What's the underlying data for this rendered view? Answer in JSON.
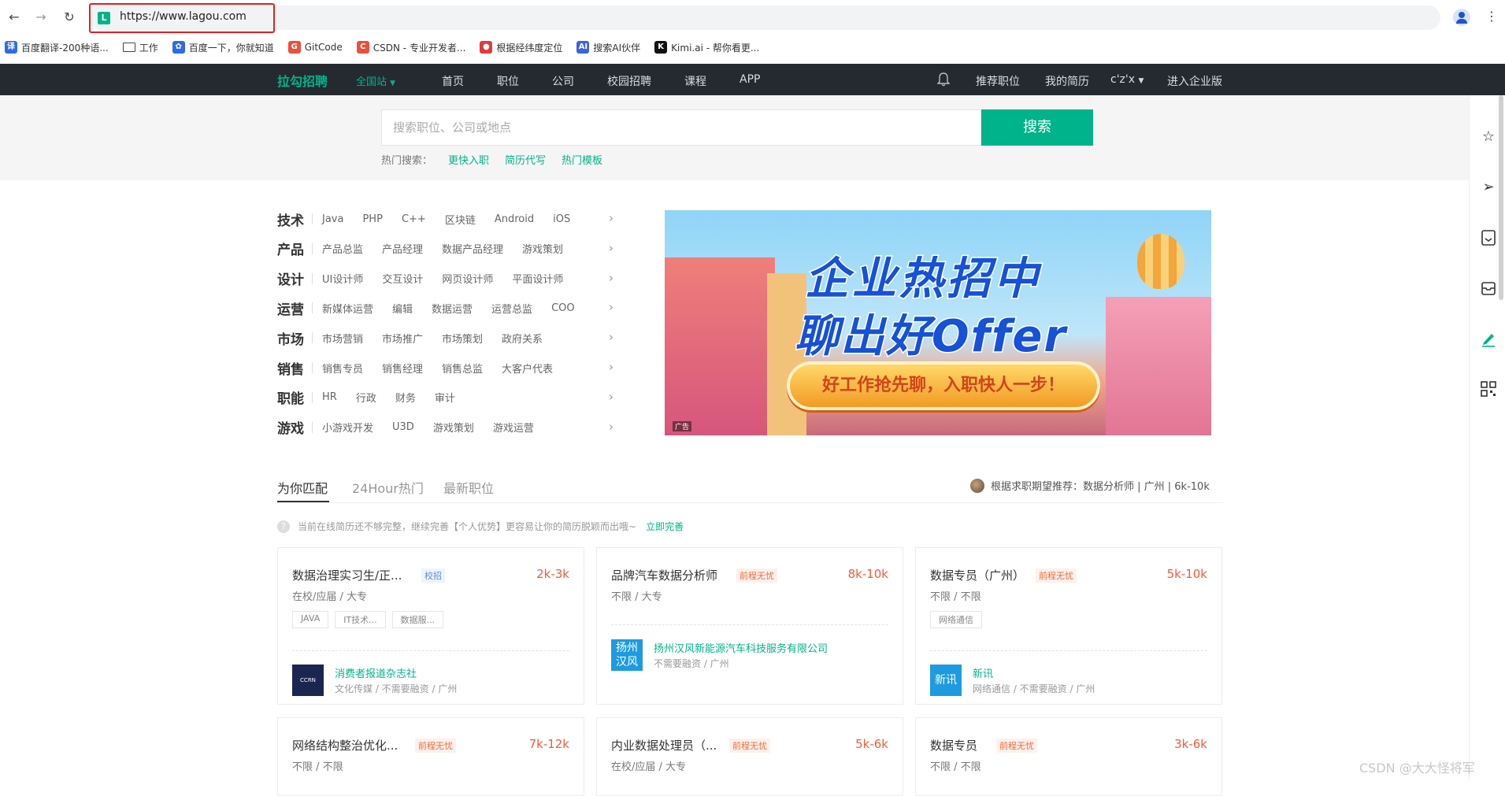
{
  "browser": {
    "url": "https://www.lagou.com",
    "favicon_letter": "L",
    "bookmarks": [
      {
        "label": "百度翻译-200种语...",
        "icon": "baidu-translate-icon",
        "color": "#2e6be6",
        "glyph": "译"
      },
      {
        "label": "工作",
        "icon": "folder-icon",
        "color": "#ffffff",
        "glyph": ""
      },
      {
        "label": "百度一下，你就知道",
        "icon": "baidu-paw-icon",
        "color": "#2e6be6",
        "glyph": "✿"
      },
      {
        "label": "GitCode",
        "icon": "gitcode-icon",
        "color": "#e9513b",
        "glyph": "G"
      },
      {
        "label": "CSDN - 专业开发者...",
        "icon": "csdn-icon",
        "color": "#e9513b",
        "glyph": "C"
      },
      {
        "label": "根据经纬度定位",
        "icon": "location-pin-icon",
        "color": "#e23a3a",
        "glyph": "●"
      },
      {
        "label": "搜索AI伙伴",
        "icon": "ai-search-icon",
        "color": "#3d63dd",
        "glyph": "AI"
      },
      {
        "label": "Kimi.ai - 帮你看更...",
        "icon": "kimi-icon",
        "color": "#111111",
        "glyph": "K"
      }
    ]
  },
  "site_nav": {
    "logo": "拉勾招聘",
    "city": "全国站",
    "links": [
      "首页",
      "职位",
      "公司",
      "校园招聘",
      "课程",
      "APP"
    ],
    "right_links": [
      "推荐职位",
      "我的简历",
      "c'z'x",
      "进入企业版"
    ]
  },
  "search": {
    "placeholder": "搜索职位、公司或地点",
    "button": "搜索",
    "hot_label": "热门搜索：",
    "hot_terms": [
      "更快入职",
      "简历代写",
      "热门模板"
    ]
  },
  "categories": [
    {
      "title": "技术",
      "items": [
        "Java",
        "PHP",
        "C++",
        "区块链",
        "Android",
        "iOS"
      ]
    },
    {
      "title": "产品",
      "items": [
        "产品总监",
        "产品经理",
        "数据产品经理",
        "游戏策划"
      ]
    },
    {
      "title": "设计",
      "items": [
        "UI设计师",
        "交互设计",
        "网页设计师",
        "平面设计师"
      ]
    },
    {
      "title": "运营",
      "items": [
        "新媒体运营",
        "编辑",
        "数据运营",
        "运营总监",
        "COO"
      ]
    },
    {
      "title": "市场",
      "items": [
        "市场营销",
        "市场推广",
        "市场策划",
        "政府关系"
      ]
    },
    {
      "title": "销售",
      "items": [
        "销售专员",
        "销售经理",
        "销售总监",
        "大客户代表"
      ]
    },
    {
      "title": "职能",
      "items": [
        "HR",
        "行政",
        "财务",
        "审计"
      ]
    },
    {
      "title": "游戏",
      "items": [
        "小游戏开发",
        "U3D",
        "游戏策划",
        "游戏运营"
      ]
    }
  ],
  "banner": {
    "line1": "企业热招中",
    "line2": "聊出好Offer",
    "slogan": "好工作抢先聊，入职快人一步！",
    "ad_label": "广告"
  },
  "tabs": [
    "为你匹配",
    "24Hour热门",
    "最新职位"
  ],
  "recommend_text": "根据求职期望推荐：数据分析师 | 广州 | 6k-10k",
  "tip": {
    "text": "当前在线简历还不够完整，继续完善【个人优势】更容易让你的简历脱颖而出哦~",
    "link": "立即完善"
  },
  "jobs": [
    {
      "title": "数据治理实习生/正...",
      "badge": "校招",
      "salary": "2k-3k",
      "req": "在校/应届 / 大专",
      "tags": [
        "JAVA",
        "IT技术...",
        "数据服..."
      ],
      "company": "消费者报道杂志社",
      "company_logo": "CCRN",
      "company_info": "文化传媒 / 不需要融资 / 广州",
      "logo_color": "#1b2650"
    },
    {
      "title": "品牌汽车数据分析师",
      "badge": "前程无忧",
      "salary": "8k-10k",
      "req": "不限 / 大专",
      "tags": [],
      "company": "扬州汉风新能源汽车科技服务有限公司",
      "company_logo": "扬州汉风",
      "company_info": "不需要融资 / 广州",
      "logo_color": "#1e9be0"
    },
    {
      "title": "数据专员（广州）",
      "badge": "前程无忧",
      "salary": "5k-10k",
      "req": "不限 / 不限",
      "tags": [
        "网络通信"
      ],
      "company": "新讯",
      "company_logo": "新讯",
      "company_info": "网络通信 / 不需要融资 / 广州",
      "logo_color": "#1e9be0"
    },
    {
      "title": "网络结构整治优化...",
      "badge": "前程无忧",
      "salary": "7k-12k",
      "req": "不限 / 不限"
    },
    {
      "title": "内业数据处理员（...",
      "badge": "前程无忧",
      "salary": "5k-6k",
      "req": "在校/应届 / 大专"
    },
    {
      "title": "数据专员",
      "badge": "前程无忧",
      "salary": "3k-6k",
      "req": "不限 / 不限"
    }
  ],
  "watermark": "CSDN @大大怪将军",
  "colors": {
    "brand": "#00b38a",
    "nav_bg": "#252a30",
    "salary": "#f35b3b"
  }
}
